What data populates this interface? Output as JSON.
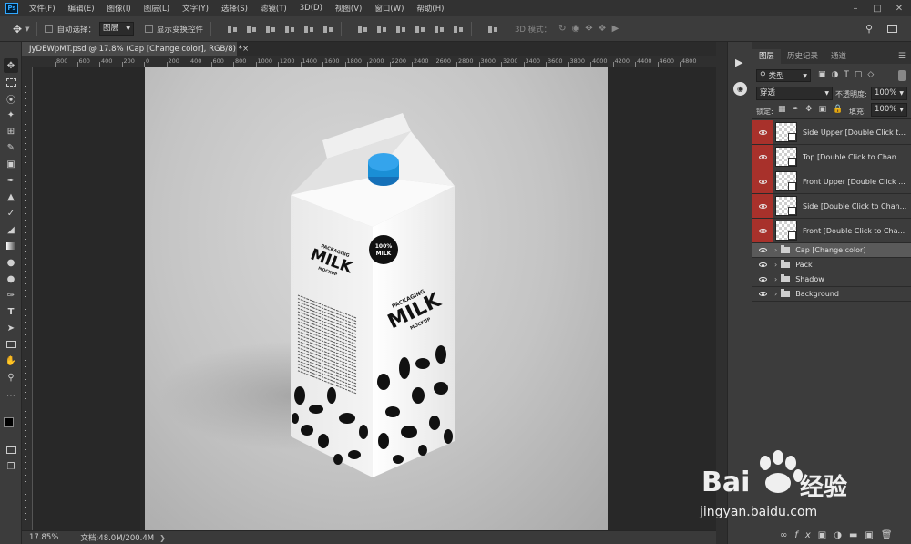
{
  "menu": {
    "logo": "Ps",
    "items": [
      "文件(F)",
      "编辑(E)",
      "图像(I)",
      "图层(L)",
      "文字(Y)",
      "选择(S)",
      "滤镜(T)",
      "3D(D)",
      "视图(V)",
      "窗口(W)",
      "帮助(H)"
    ]
  },
  "options": {
    "auto_select_label": "自动选择：",
    "auto_select_value": "图层",
    "show_transform_label": "显示变换控件",
    "mode_3d_label": "3D 模式："
  },
  "document": {
    "tab_title": "JyDEWpMT.psd @ 17.8% (Cap [Change color], RGB/8) *",
    "close": "×"
  },
  "ruler": {
    "h_labels": [
      "800",
      "600",
      "400",
      "200",
      "0",
      "200",
      "400",
      "600",
      "800",
      "1000",
      "1200",
      "1400",
      "1600",
      "1800",
      "2000",
      "2200",
      "2400",
      "2600",
      "2800",
      "3000",
      "3200",
      "3400",
      "3600",
      "3800",
      "4000",
      "4200",
      "4400",
      "4600",
      "4800"
    ]
  },
  "status": {
    "zoom": "17.85%",
    "doc_size": "文档:48.0M/200.4M"
  },
  "panel": {
    "tabs": [
      "图层",
      "历史记录",
      "通道"
    ],
    "filter_label": "类型",
    "blend_mode": "穿透",
    "opacity_label": "不透明度:",
    "opacity_value": "100%",
    "lock_label": "锁定:",
    "fill_label": "填充:",
    "fill_value": "100%"
  },
  "layers": [
    {
      "name": "Side Upper [Double Click t...",
      "type": "smart",
      "highlight": true
    },
    {
      "name": "Top [Double Click to Chan...",
      "type": "smart",
      "highlight": true
    },
    {
      "name": "Front Upper [Double Click ...",
      "type": "smart",
      "highlight": true
    },
    {
      "name": "Side [Double Click to Chan...",
      "type": "smart",
      "highlight": true
    },
    {
      "name": "Front [Double Click to Cha...",
      "type": "smart",
      "highlight": true
    },
    {
      "name": "Cap [Change color]",
      "type": "group",
      "selected": true
    },
    {
      "name": "Pack",
      "type": "group"
    },
    {
      "name": "Shadow",
      "type": "group"
    },
    {
      "name": "Background",
      "type": "group"
    }
  ],
  "artwork": {
    "left_brand": "MILK",
    "left_top": "PACKAGING",
    "left_bottom": "MOCKUP",
    "front_top": "PACKAGING",
    "front_brand": "MILK",
    "front_bottom": "MOCKUP",
    "badge_top": "100%",
    "badge_bottom": "MILK"
  },
  "watermark": {
    "brand": "Bai",
    "brand_tail": "经验",
    "url": "jingyan.baidu.com"
  },
  "colors": {
    "accent_red": "#a8312b",
    "cap_blue": "#1a8fd6",
    "selection": "#5a5a5a"
  }
}
